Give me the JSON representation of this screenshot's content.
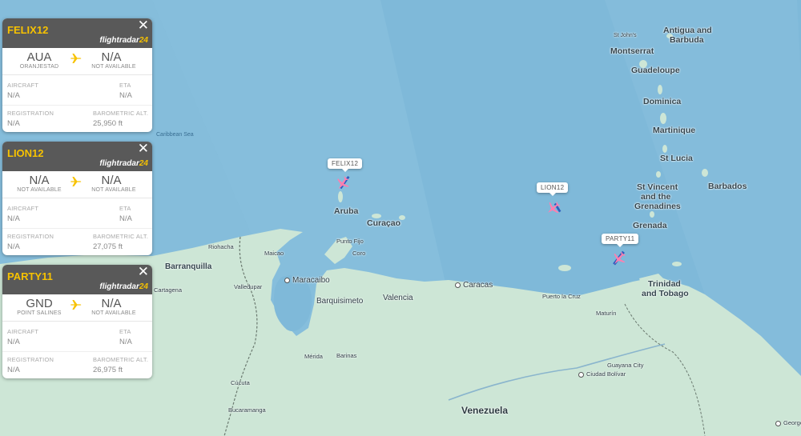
{
  "cards": [
    {
      "callsign": "FELIX12",
      "brand_main": "flightradar",
      "brand_accent": "24",
      "close_glyph": "✕",
      "from_code": "AUA",
      "from_name": "ORANJESTAD",
      "to_code": "N/A",
      "to_name": "NOT AVAILABLE",
      "aircraft_label": "AIRCRAFT",
      "aircraft_value": "N/A",
      "eta_label": "ETA",
      "eta_value": "N/A",
      "registration_label": "REGISTRATION",
      "registration_value": "N/A",
      "alt_label": "BAROMETRIC ALT.",
      "alt_value": "25,950 ft"
    },
    {
      "callsign": "LION12",
      "brand_main": "flightradar",
      "brand_accent": "24",
      "close_glyph": "✕",
      "from_code": "N/A",
      "from_name": "NOT AVAILABLE",
      "to_code": "N/A",
      "to_name": "NOT AVAILABLE",
      "aircraft_label": "AIRCRAFT",
      "aircraft_value": "N/A",
      "eta_label": "ETA",
      "eta_value": "N/A",
      "registration_label": "REGISTRATION",
      "registration_value": "N/A",
      "alt_label": "BAROMETRIC ALT.",
      "alt_value": "27,075 ft"
    },
    {
      "callsign": "PARTY11",
      "brand_main": "flightradar",
      "brand_accent": "24",
      "close_glyph": "✕",
      "from_code": "GND",
      "from_name": "POINT SALINES",
      "to_code": "N/A",
      "to_name": "NOT AVAILABLE",
      "aircraft_label": "AIRCRAFT",
      "aircraft_value": "N/A",
      "eta_label": "ETA",
      "eta_value": "N/A",
      "registration_label": "REGISTRATION",
      "registration_value": "N/A",
      "alt_label": "BAROMETRIC ALT.",
      "alt_value": "26,975 ft"
    }
  ],
  "aircraft_tags": [
    "FELIX12",
    "LION12",
    "PARTY11"
  ],
  "map": {
    "sea_label": "Caribbean Sea",
    "country": "Venezuela",
    "islands": [
      "Antigua and",
      "Barbuda",
      "St John's",
      "Montserrat",
      "Guadeloupe",
      "Dominica",
      "Martinique",
      "St Lucia",
      "St Vincent",
      "and the",
      "Grenadines",
      "Barbados",
      "Grenada",
      "Trinidad",
      "and Tobago",
      "Aruba",
      "Curaçao"
    ],
    "cities": [
      "Barranquilla",
      "Riohacha",
      "Maicao",
      "Maracaibo",
      "Valledupar",
      "Cartagena",
      "Punto Fijo",
      "Coro",
      "Barquisimeto",
      "Valencia",
      "Caracas",
      "Puerto la Cruz",
      "Maturín",
      "Mérida",
      "Barinas",
      "Cúcuta",
      "Bucaramanga",
      "Guayana City",
      "Ciudad Bolívar",
      "Georgetown"
    ]
  },
  "colors": {
    "sea": "#7fb9d9",
    "land": "#cde6d6",
    "header": "#595959",
    "callsign": "#f7c200",
    "plane_icon": "#f7c200",
    "aircraft_selected": "#ff7fb0",
    "aircraft_trail": "#2f5fbf"
  }
}
